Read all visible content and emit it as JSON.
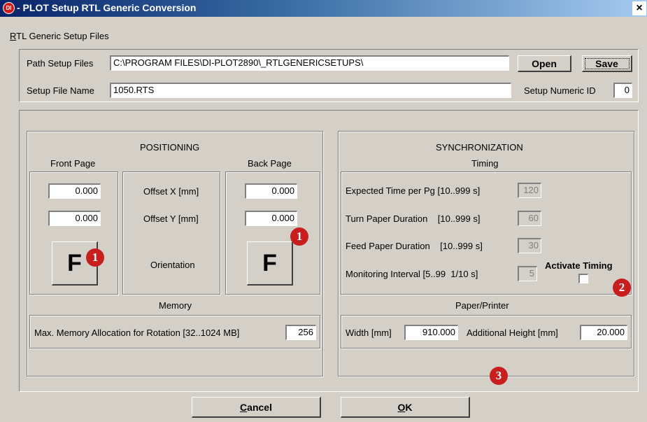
{
  "window": {
    "title": "- PLOT  Setup RTL Generic  Conversion",
    "icon_text": "DI",
    "close_label": "×"
  },
  "menu": {
    "item": "RTL Generic Setup Files"
  },
  "top": {
    "path_label": "Path Setup Files",
    "path_value": "C:\\PROGRAM FILES\\DI-PLOT2890\\_RTLGENERICSETUPS\\",
    "open_label": "Open",
    "save_label": "Save",
    "name_label": "Setup File Name",
    "name_value": "1050.RTS",
    "numeric_id_label": "Setup Numeric ID",
    "numeric_id_value": "0"
  },
  "positioning": {
    "title": "POSITIONING",
    "front_label": "Front Page",
    "back_label": "Back Page",
    "offset_x_label": "Offset X [mm]",
    "offset_y_label": "Offset Y [mm]",
    "orientation_label": "Orientation",
    "front_x": "0.000",
    "front_y": "0.000",
    "back_x": "0.000",
    "back_y": "0.000",
    "front_orientation": "F",
    "back_orientation": "F"
  },
  "memory": {
    "title": "Memory",
    "label": "Max. Memory Allocation for Rotation [32..1024 MB]",
    "value": "256"
  },
  "sync": {
    "title": "SYNCHRONIZATION",
    "timing_title": "Timing",
    "expected_label": "Expected Time per Pg [10..999 s]",
    "expected_value": "120",
    "turn_label": "Turn Paper Duration    [10..999 s]",
    "turn_value": "60",
    "feed_label": "Feed Paper Duration    [10..999 s]",
    "feed_value": "30",
    "monitor_label": "Monitoring Interval [5..99  1/10 s]",
    "monitor_value": "5",
    "activate_label": "Activate Timing"
  },
  "paper": {
    "title": "Paper/Printer",
    "width_label": "Width [mm]",
    "width_value": "910.000",
    "height_label": "Additional Height [mm]",
    "height_value": "20.000"
  },
  "buttons": {
    "cancel": "Cancel",
    "ok": "OK"
  },
  "badges": {
    "one": "1",
    "two": "2",
    "three": "3"
  },
  "colors": {
    "badge": "#c81e1e",
    "title_start": "#0a246a",
    "dialog": "#d4d0c8"
  }
}
